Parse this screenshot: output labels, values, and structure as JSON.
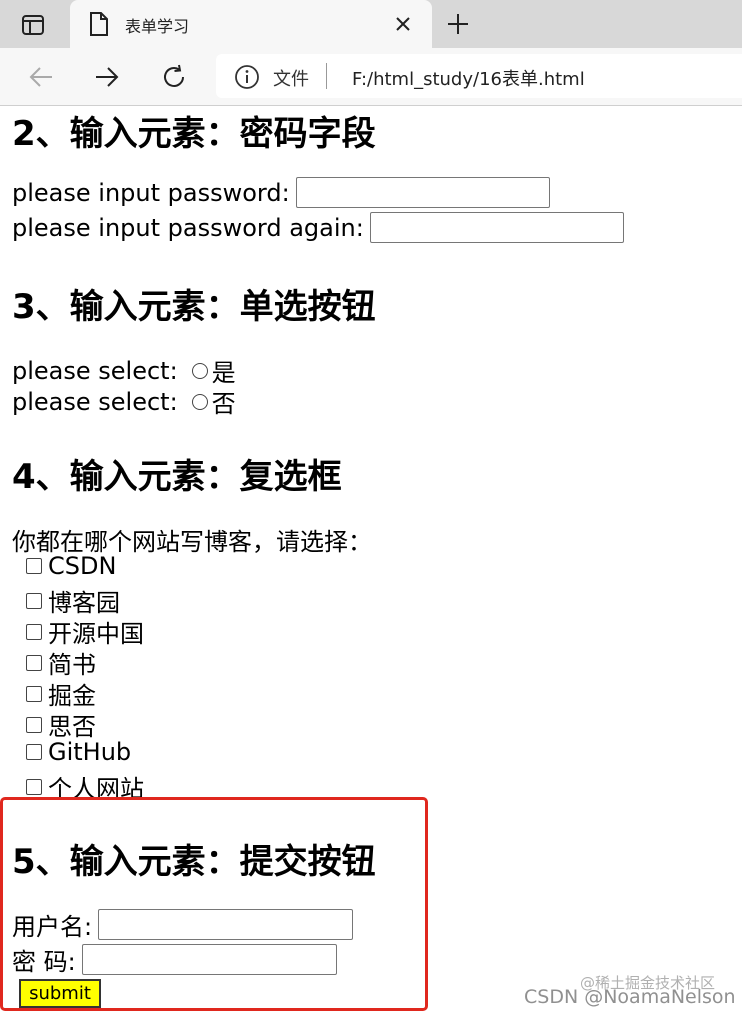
{
  "browser": {
    "tab_title": "表单学习",
    "address_label": "文件",
    "url": "F:/html_study/16表单.html"
  },
  "sections": {
    "password": {
      "heading": "2、输入元素：密码字段",
      "label1": "please input password:",
      "label2": "please input password again:"
    },
    "radio": {
      "heading": "3、输入元素：单选按钮",
      "label1": "please select:",
      "option1": "是",
      "label2": "please select:",
      "option2": "否"
    },
    "checkbox": {
      "heading": "4、输入元素：复选框",
      "prompt": "你都在哪个网站写博客，请选择：",
      "options": [
        "CSDN",
        "博客园",
        "开源中国",
        "简书",
        "掘金",
        "思否",
        "GitHub",
        "个人网站"
      ]
    },
    "submit": {
      "heading": "5、输入元素：提交按钮",
      "username_label": "用户名:",
      "password_label": "密 码:",
      "button_label": "submit"
    }
  },
  "watermark": {
    "line1": "@稀土掘金技术社区",
    "line2": "CSDN @NoamaNelson"
  },
  "colors": {
    "highlight_border": "#e0281e",
    "submit_bg": "#ffff00"
  }
}
